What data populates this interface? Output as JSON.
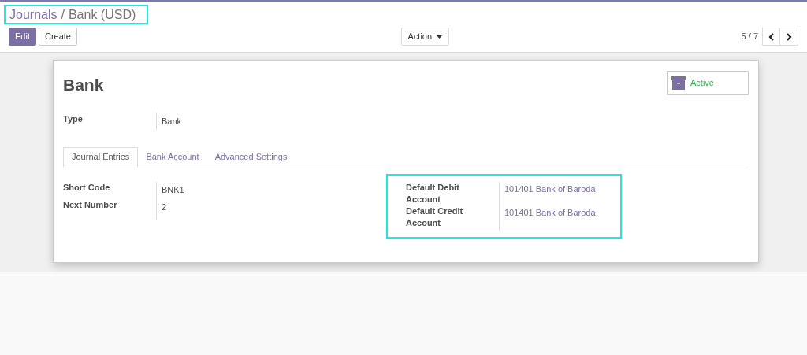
{
  "breadcrumb": {
    "parent": "Journals",
    "separator": "/",
    "current": "Bank (USD)",
    "highlighted": true
  },
  "buttons": {
    "edit": "Edit",
    "create": "Create",
    "action": "Action"
  },
  "pager": {
    "text": "5 / 7"
  },
  "record": {
    "title": "Bank",
    "status": {
      "label": "Active",
      "active": true
    },
    "type": {
      "label": "Type",
      "value": "Bank"
    }
  },
  "tabs": [
    {
      "label": "Journal Entries",
      "selected": true
    },
    {
      "label": "Bank Account",
      "selected": false
    },
    {
      "label": "Advanced Settings",
      "selected": false
    }
  ],
  "left_fields": [
    {
      "label": "Short Code",
      "value": "BNK1"
    },
    {
      "label": "Next Number",
      "value": "2"
    }
  ],
  "right_group": {
    "highlighted": true,
    "fields": [
      {
        "label": "Default Debit Account",
        "value": "101401 Bank of Baroda"
      },
      {
        "label": "Default Credit Account",
        "value": "101401 Bank of Baroda"
      }
    ]
  }
}
